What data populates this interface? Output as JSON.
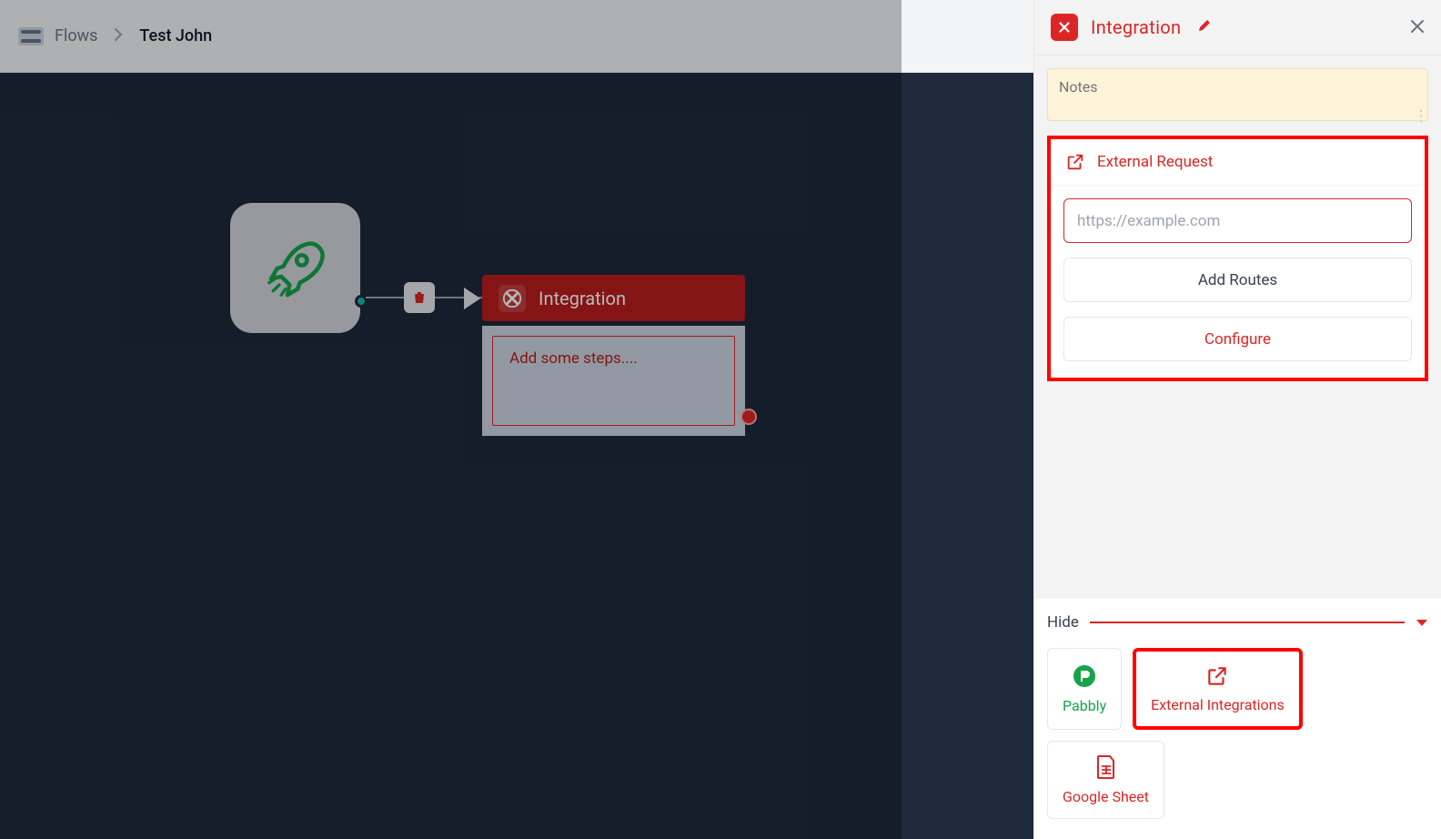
{
  "breadcrumb": {
    "root": "Flows",
    "current": "Test John"
  },
  "canvas": {
    "integration_label": "Integration",
    "steps_placeholder": "Add some steps...."
  },
  "panel": {
    "title": "Integration",
    "notes_placeholder": "Notes",
    "external_request": {
      "title": "External Request",
      "url_placeholder": "https://example.com",
      "add_routes": "Add Routes",
      "configure": "Configure"
    },
    "hide_label": "Hide",
    "tiles": {
      "pabbly": "Pabbly",
      "external": "External Integrations",
      "gsheet": "Google Sheet"
    }
  }
}
